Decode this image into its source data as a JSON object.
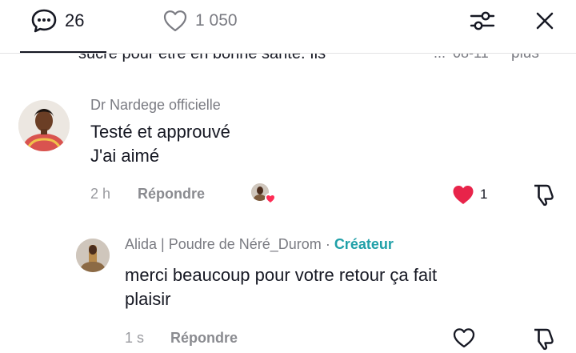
{
  "header": {
    "comments_count": "26",
    "likes_count": "1 050"
  },
  "clipped_comment": {
    "text": "sucré pour être en bonne santé. Ils",
    "ellipsis": "...",
    "date": "08-11",
    "more": "plus"
  },
  "comments": [
    {
      "username": "Dr Nardege officielle",
      "text_line1": "Testé et approuvé",
      "text_line2": "J'ai aimé",
      "time": "2 h",
      "reply_label": "Répondre",
      "like_count": "1",
      "liked": true
    },
    {
      "username": "Alida | Poudre de Néré_Durom",
      "separator": " · ",
      "badge": "Créateur",
      "text_line1": "merci beaucoup pour votre retour ça fait",
      "text_line2": "plaisir",
      "time": "1 s",
      "reply_label": "Répondre",
      "liked": false
    }
  ],
  "colors": {
    "like_red": "#fe2c55",
    "creator_teal": "#20a0a8",
    "text_dark": "#161823",
    "text_gray": "#7a7b82"
  }
}
